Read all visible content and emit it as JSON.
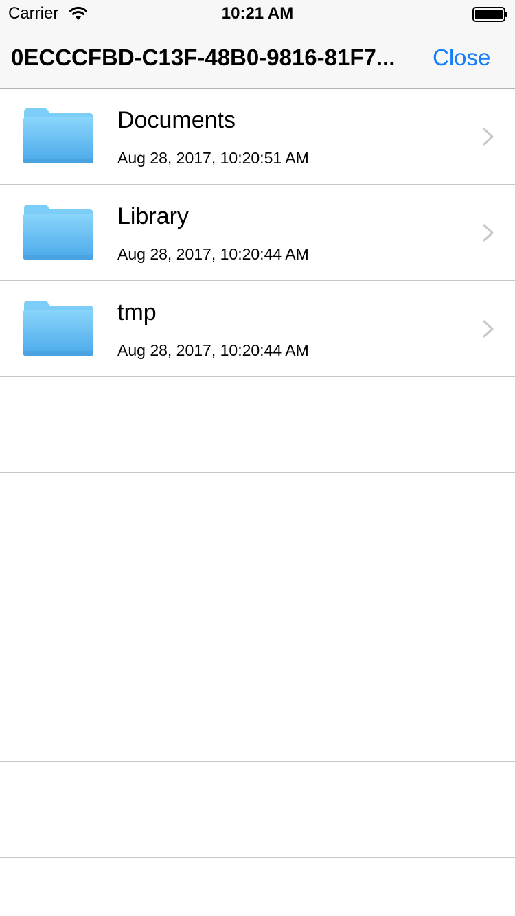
{
  "status_bar": {
    "carrier": "Carrier",
    "time": "10:21 AM",
    "wifi_icon": "wifi-icon",
    "battery_icon": "battery-full-icon"
  },
  "nav": {
    "title": "0ECCCFBD-C13F-48B0-9816-81F7...",
    "close_label": "Close",
    "accent_color": "#157efb"
  },
  "files": [
    {
      "name": "Documents",
      "date": "Aug 28, 2017, 10:20:51 AM",
      "icon": "folder-icon"
    },
    {
      "name": "Library",
      "date": "Aug 28, 2017, 10:20:44 AM",
      "icon": "folder-icon"
    },
    {
      "name": "tmp",
      "date": "Aug 28, 2017, 10:20:44 AM",
      "icon": "folder-icon"
    }
  ],
  "colors": {
    "folder_light": "#7fd0fb",
    "folder_dark": "#53b4f0",
    "chevron": "#c7c7cc",
    "separator": "#c8c7cc"
  }
}
